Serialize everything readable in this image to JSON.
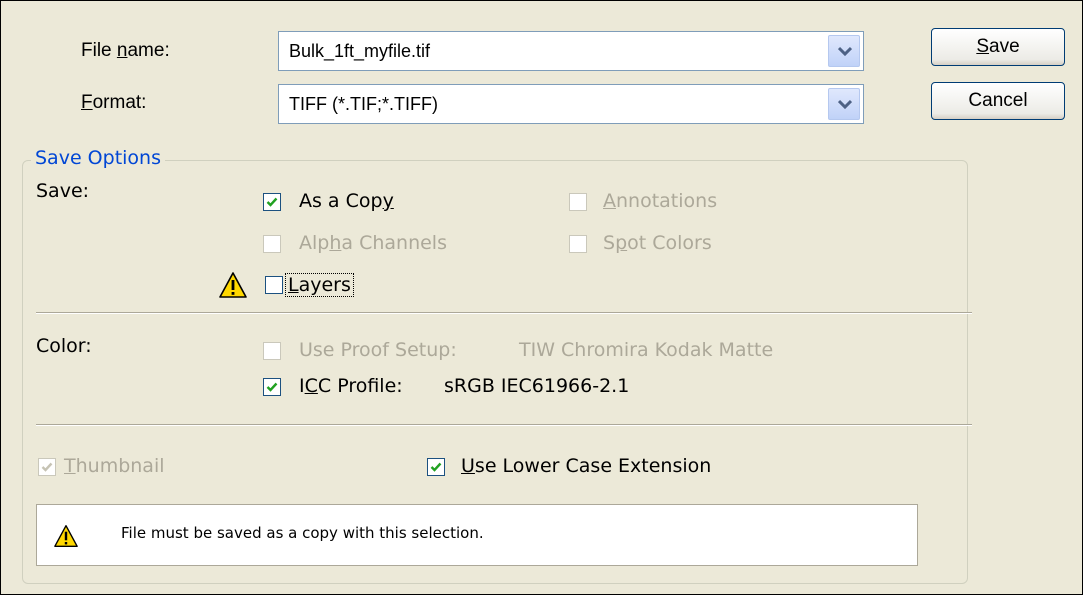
{
  "file_name": {
    "label_pre": "File ",
    "label_accel": "n",
    "label_post": "ame:",
    "value": "Bulk_1ft_myfile.tif"
  },
  "format": {
    "label_accel": "F",
    "label_post": "ormat:",
    "value": "TIFF (*.TIF;*.TIFF)"
  },
  "buttons": {
    "save_accel": "S",
    "save_rest": "ave",
    "cancel": "Cancel"
  },
  "save_options": {
    "legend": "Save Options",
    "save_label": "Save:",
    "as_a_copy": {
      "pre": "As a Cop",
      "accel": "y",
      "post": "",
      "checked": true,
      "enabled": true
    },
    "annotations": {
      "pre": "",
      "accel": "A",
      "post": "nnotations",
      "checked": false,
      "enabled": false
    },
    "alpha_channels": {
      "pre": "Alp",
      "accel": "h",
      "post": "a Channels",
      "checked": false,
      "enabled": false
    },
    "spot_colors": {
      "pre": "S",
      "accel": "p",
      "post": "ot Colors",
      "checked": false,
      "enabled": false
    },
    "layers": {
      "pre": "",
      "accel": "L",
      "post": "ayers",
      "checked": false,
      "enabled": true
    },
    "color_label": "Color:",
    "use_proof_setup": {
      "label": "Use Proof Setup:",
      "value": "TIW Chromira Kodak Matte",
      "checked": false,
      "enabled": false
    },
    "icc_profile": {
      "pre": "I",
      "accel": "C",
      "post": "C Profile:",
      "value": "sRGB IEC61966-2.1",
      "checked": true,
      "enabled": true
    },
    "thumbnail": {
      "pre": "",
      "accel": "T",
      "post": "humbnail",
      "checked": true,
      "enabled": false
    },
    "lower_case_ext": {
      "pre": "",
      "accel": "U",
      "post": "se Lower Case Extension",
      "checked": true,
      "enabled": true
    }
  },
  "warning": {
    "message": "File must be saved as a copy with this selection."
  },
  "colors": {
    "dialog_bg": "#ece9d8",
    "legend_text": "#0046d5",
    "disabled_text": "#aca899",
    "check": "#21a121",
    "warning_yellow": "#ffd800"
  },
  "icons": {
    "dropdown": "chevron-down-icon",
    "warning": "warning-icon",
    "check": "checkmark-icon"
  }
}
